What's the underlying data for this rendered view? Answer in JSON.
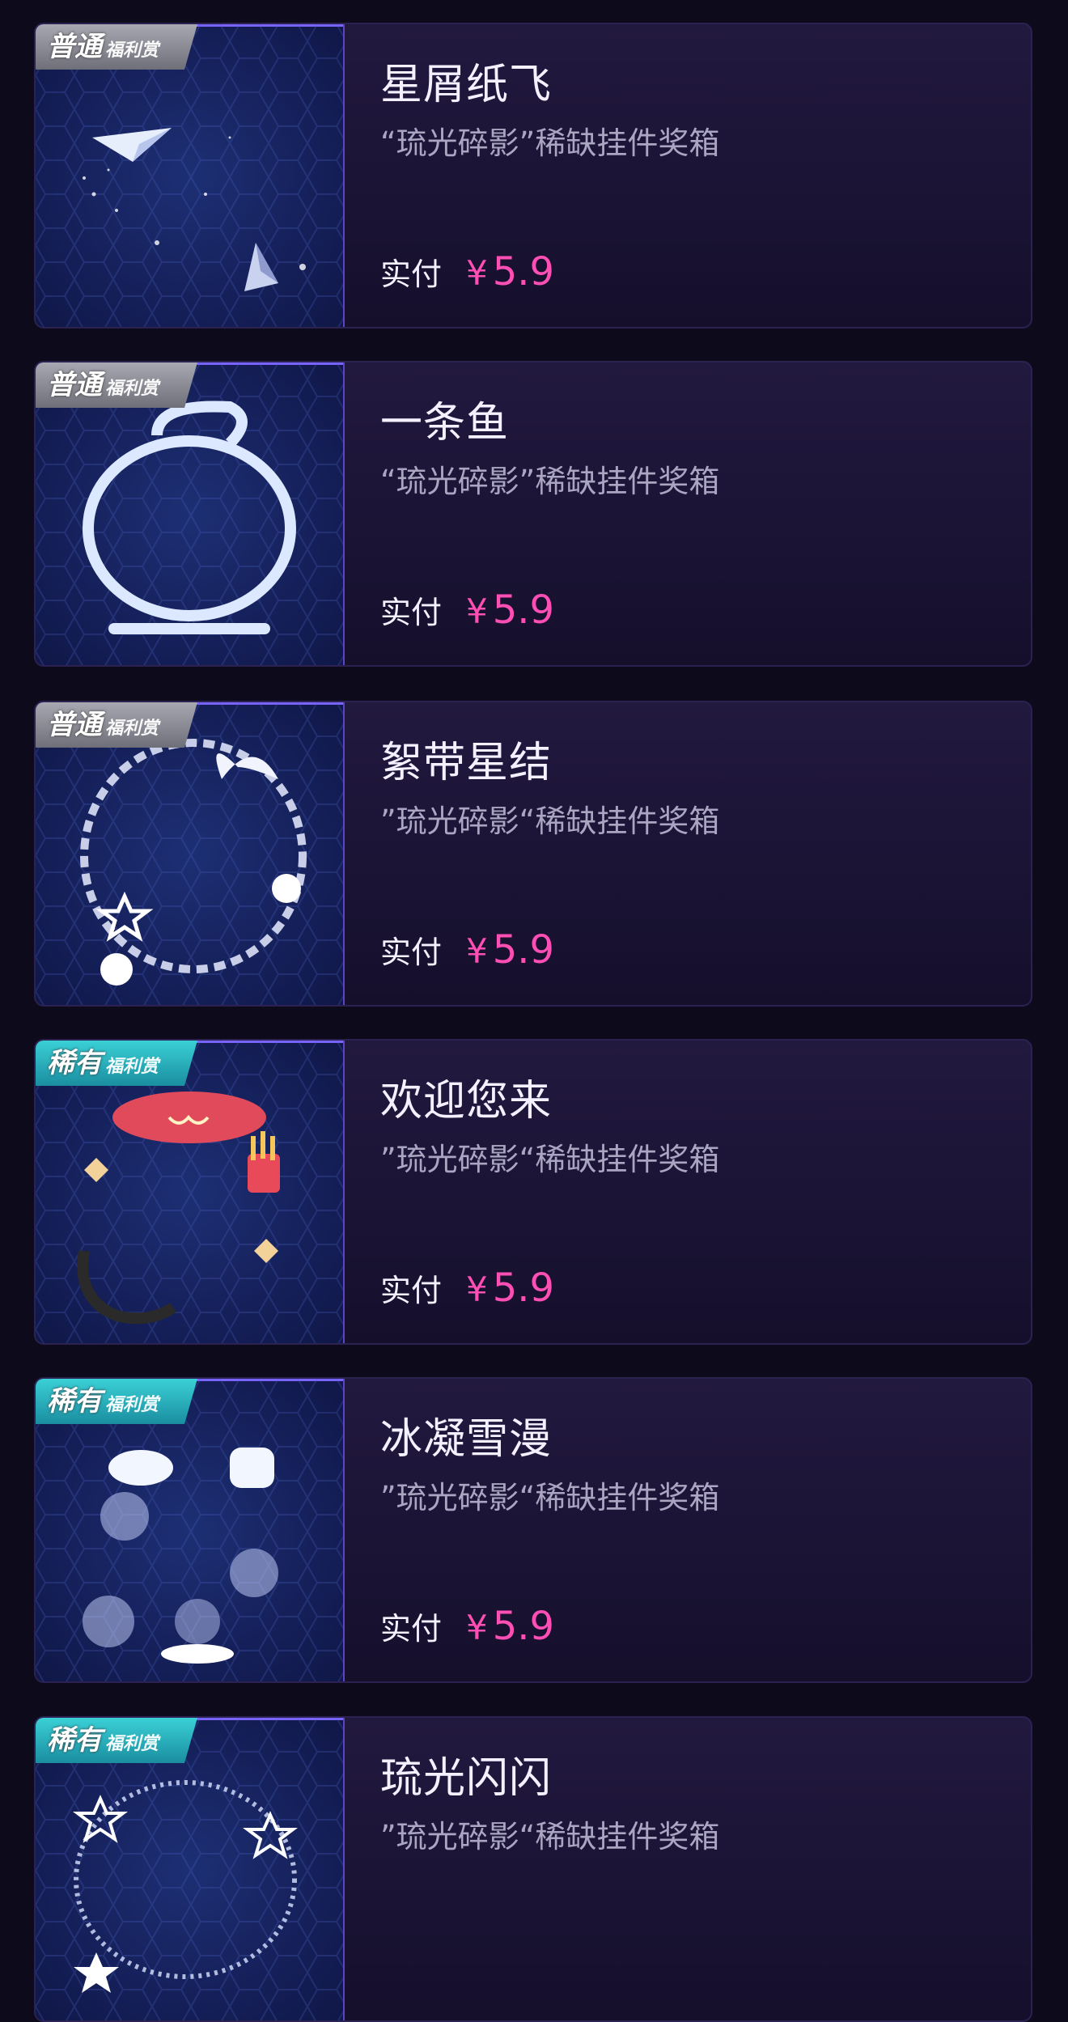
{
  "items": [
    {
      "title": "星屑纸飞",
      "subtitle": "“琉光碎影”稀缺挂件奖箱",
      "badge_main": "普通",
      "badge_sub": "福利赏",
      "badge_type": "normal",
      "pay_label": "实付",
      "currency": "¥",
      "price": "5.9",
      "icon": "paper-plane-icon"
    },
    {
      "title": "一条鱼",
      "subtitle": "“琉光碎影”稀缺挂件奖箱",
      "badge_main": "普通",
      "badge_sub": "福利赏",
      "badge_type": "normal",
      "pay_label": "实付",
      "currency": "¥",
      "price": "5.9",
      "icon": "fish-bowl-frame-icon"
    },
    {
      "title": "絮带星结",
      "subtitle": "”琉光碎影“稀缺挂件奖箱",
      "badge_main": "普通",
      "badge_sub": "福利赏",
      "badge_type": "normal",
      "pay_label": "实付",
      "currency": "¥",
      "price": "5.9",
      "icon": "ribbon-star-frame-icon"
    },
    {
      "title": "欢迎您来",
      "subtitle": "”琉光碎影“稀缺挂件奖箱",
      "badge_main": "稀有",
      "badge_sub": "福利赏",
      "badge_type": "rare",
      "pay_label": "实付",
      "currency": "¥",
      "price": "5.9",
      "icon": "snack-frame-icon"
    },
    {
      "title": "冰凝雪漫",
      "subtitle": "”琉光碎影“稀缺挂件奖箱",
      "badge_main": "稀有",
      "badge_sub": "福利赏",
      "badge_type": "rare",
      "pay_label": "实付",
      "currency": "¥",
      "price": "5.9",
      "icon": "snow-frame-icon"
    },
    {
      "title": "琉光闪闪",
      "subtitle": "”琉光碎影“稀缺挂件奖箱",
      "badge_main": "稀有",
      "badge_sub": "福利赏",
      "badge_type": "rare",
      "pay_label": "",
      "currency": "",
      "price": "",
      "icon": "sparkle-star-frame-icon"
    }
  ],
  "colors": {
    "price": "#ff4fb4",
    "badge_normal": "#8f8f9a",
    "badge_rare": "#2ab6c4",
    "background": "#0d0a1c"
  }
}
